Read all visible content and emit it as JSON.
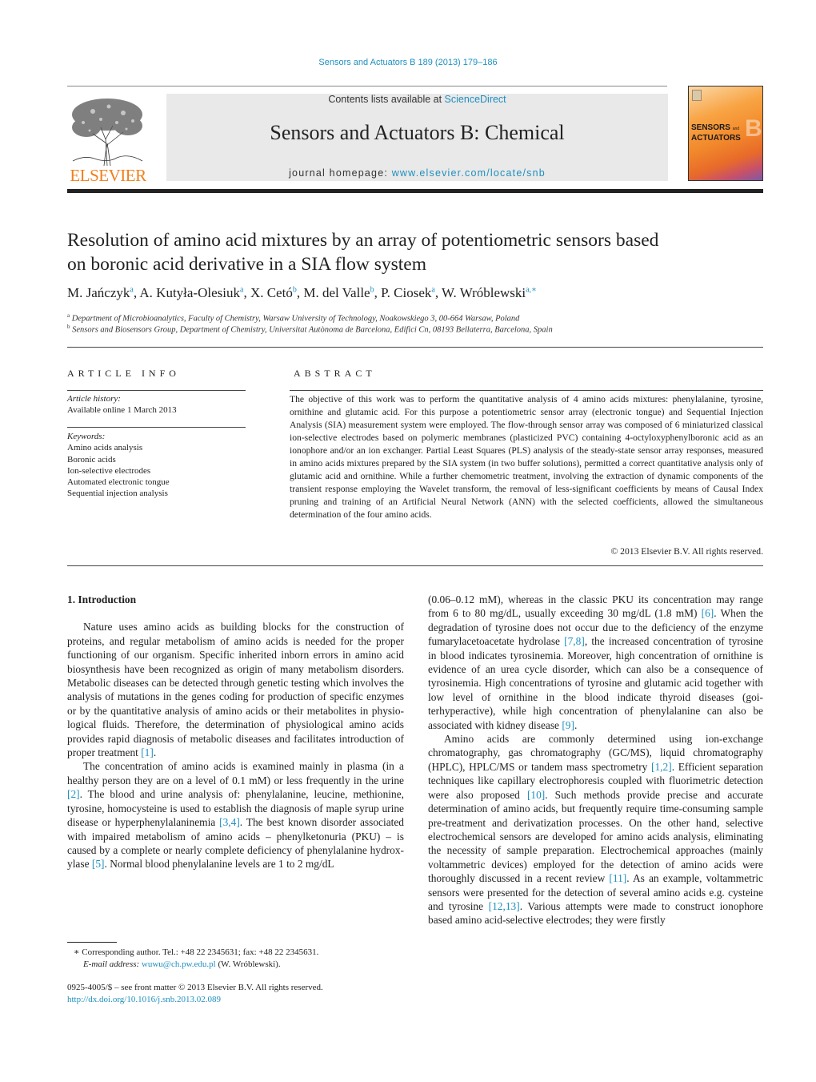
{
  "header": {
    "citation": "Sensors and Actuators B 189 (2013) 179–186",
    "publisher_wordmark": "ELSEVIER",
    "contents_prefix": "Contents lists available at ",
    "contents_link": "ScienceDirect",
    "journal_title": "Sensors and Actuators B: Chemical",
    "homepage_prefix": "journal homepage: ",
    "homepage_link": "www.elsevier.com/locate/snb",
    "cover": {
      "line1": "SENSORS",
      "and": "and",
      "line2": "ACTUATORS",
      "big_letter": "B"
    }
  },
  "article": {
    "title_line1": "Resolution of amino acid mixtures by an array of potentiometric sensors based",
    "title_line2": "on boronic acid derivative in a SIA flow system",
    "authors": [
      {
        "name": "M. Jańczyk",
        "aff": "a",
        "sep": ", "
      },
      {
        "name": "A. Kutyła-Olesiuk",
        "aff": "a",
        "sep": ", "
      },
      {
        "name": "X. Cetó",
        "aff": "b",
        "sep": ", "
      },
      {
        "name": "M. del Valle",
        "aff": "b",
        "sep": ", "
      },
      {
        "name": "P. Ciosek",
        "aff": "a",
        "sep": ", "
      },
      {
        "name": "W. Wróblewski",
        "aff": "a,∗",
        "sep": ""
      }
    ],
    "affiliations": [
      {
        "mark": "a",
        "text": "Department of Microbioanalytics, Faculty of Chemistry, Warsaw University of Technology, Noakowskiego 3, 00-664 Warsaw, Poland"
      },
      {
        "mark": "b",
        "text": "Sensors and Biosensors Group, Department of Chemistry, Universitat Autònoma de Barcelona, Edifici Cn, 08193 Bellaterra, Barcelona, Spain"
      }
    ]
  },
  "article_info": {
    "label": "ARTICLE INFO",
    "history_label": "Article history:",
    "history_value": "Available online 1 March 2013",
    "keywords_label": "Keywords:",
    "keywords": [
      "Amino acids analysis",
      "Boronic acids",
      "Ion-selective electrodes",
      "Automated electronic tongue",
      "Sequential injection analysis"
    ]
  },
  "abstract": {
    "label": "ABSTRACT",
    "text": "The objective of this work was to perform the quantitative analysis of 4 amino acids mixtures: phenyl­alanine, tyrosine, ornithine and glutamic acid. For this purpose a potentiometric sensor array (electronic tongue) and Sequential Injection Analysis (SIA) measurement system were employed. The flow-through sensor array was composed of 6 miniaturized classical ion-selective electrodes based on polymeric membranes (plasticized PVC) containing 4-octyloxyphenylboronic acid as an ionophore and/or an ion exchanger. Partial Least Squares (PLS) analysis of the steady-state sensor array responses, measured in amino acids mixtures prepared by the SIA system (in two buffer solutions), permitted a correct quan­titative analysis only of glutamic acid and ornithine. While a further chemometric treatment, involving the extraction of dynamic components of the transient response employing the Wavelet transform, the removal of less-significant coefficients by means of Causal Index pruning and training of an Artificial Neural Network (ANN) with the selected coefficients, allowed the simultaneous determination of the four amino acids.",
    "copyright": "© 2013 Elsevier B.V. All rights reserved."
  },
  "body": {
    "section_heading": "1.  Introduction",
    "left_paragraphs": [
      [
        {
          "t": "Nature uses amino acids as building blocks for the construction of proteins, and regular metabolism of amino acids is needed for the proper functioning of our organism. Specific inherited inborn errors in amino acid biosynthesis have been recognized as origin of many metabolism disorders. Metabolic diseases can be detected through genetic testing which involves the analysis of mutations in the genes coding for production of specific enzymes or by the quantitative analysis of amino acids or their metabolites in physio­logical fluids. Therefore, the determination of physiological amino acids provides rapid diagnosis of metabolic diseases and facilitates introduction of proper treatment "
        },
        {
          "ref": "[1]"
        },
        {
          "t": "."
        }
      ],
      [
        {
          "t": "The concentration of amino acids is examined mainly in plasma (in a healthy person they are on a level of 0.1 mM) or less frequently in the urine "
        },
        {
          "ref": "[2]"
        },
        {
          "t": ". The blood and urine analysis of: phenylalanine, leucine, methionine, tyrosine, homocysteine is used to establish the diagnosis of maple syrup urine disease or hyperphenylala­ninemia "
        },
        {
          "ref": "[3,4]"
        },
        {
          "t": ". The best known disorder associated with impaired metabolism of amino acids – phenylketonuria (PKU) – is caused by a complete or nearly complete deficiency of phenylalanine hydrox­ylase "
        },
        {
          "ref": "[5]"
        },
        {
          "t": ". Normal blood phenylalanine levels are 1 to 2 mg/dL"
        }
      ]
    ],
    "right_paragraphs": [
      [
        {
          "t": "(0.06–0.12 mM), whereas in the classic PKU its concentration may range from 6 to 80 mg/dL, usually exceeding 30 mg/dL (1.8 mM) "
        },
        {
          "ref": "[6]"
        },
        {
          "t": ". When the degradation of tyrosine does not occur due to the deficiency of the enzyme fumarylacetoacetate hydrolase "
        },
        {
          "ref": "[7,8]"
        },
        {
          "t": ", the increased concentration of tyrosine in blood indicates tyrosinemia. Moreover, high concentration of ornithine is evidence of an urea cycle disorder, which can also be a consequence of tyrosinemia. High concentrations of tyrosine and glutamic acid together with low level of ornithine in the blood indicate thyroid diseases (goi­terhyperactive), while high concentration of phenylalanine can also be associated with kidney disease "
        },
        {
          "ref": "[9]"
        },
        {
          "t": "."
        }
      ],
      [
        {
          "t": "Amino acids are commonly determined using ion-exchange chromatography, gas chromatography (GC/MS), liquid chromatog­raphy (HPLC), HPLC/MS or tandem mass spectrometry "
        },
        {
          "ref": "[1,2]"
        },
        {
          "t": ". Efficient separation techniques like capillary electrophoresis coupled with fluorimetric detection were also proposed "
        },
        {
          "ref": "[10]"
        },
        {
          "t": ". Such methods provide precise and accurate determination of amino acids, but frequently require time-consuming sample pre-treatment and derivatization processes. On the other hand, selective electrochemical sensors are developed for amino acids analysis, eliminating the necessity of sample preparation. Elec­trochemical approaches (mainly voltammetric devices) employed for the detection of amino acids were thoroughly discussed in a recent review "
        },
        {
          "ref": "[11]"
        },
        {
          "t": ". As an example, voltammetric sensors were presented for the detection of several amino acids e.g. cysteine and tyrosine "
        },
        {
          "ref": "[12,13]"
        },
        {
          "t": ". Various attempts were made to construct ionophore based amino acid-selective electrodes; they were firstly"
        }
      ]
    ]
  },
  "footnote": {
    "mark": "∗",
    "corresponding": "Corresponding author. Tel.: +48 22 2345631; fax: +48 22 2345631.",
    "email_label": "E-mail address: ",
    "email": "wuwu@ch.pw.edu.pl",
    "email_suffix": " (W. Wróblewski)."
  },
  "front_matter": {
    "issn_line": "0925-4005/$ – see front matter © 2013 Elsevier B.V. All rights reserved.",
    "doi": "http://dx.doi.org/10.1016/j.snb.2013.02.089"
  },
  "colors": {
    "link": "#1f8fbf",
    "elsevier_orange": "#f07f1b",
    "header_box": "#e9e9e9"
  }
}
